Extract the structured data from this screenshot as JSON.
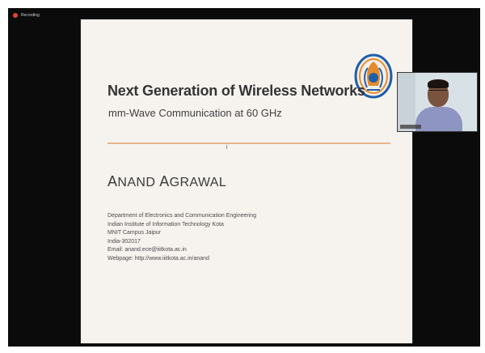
{
  "recording": {
    "label": "Recording",
    "dot_color": "#e0452f"
  },
  "slide": {
    "title": "Next Generation of Wireless Networks",
    "subtitle": "mm-Wave Communication at 60 GHz",
    "author_first_initial": "A",
    "author_first_rest": "NAND",
    "author_last_initial": "A",
    "author_last_rest": "GRAWAL",
    "affiliation": [
      "Department of Electronics and Communication Engineering",
      "Indian Institute of Information Technology Kota",
      "MNIT Campus Jaipur",
      "India-302017",
      "Email: anand.ece@iiitkota.ac.in",
      "Webpage: http://www.iiitkota.ac.in/anand"
    ],
    "accent_color": "#e8b28b"
  },
  "webcam": {
    "present": true
  }
}
